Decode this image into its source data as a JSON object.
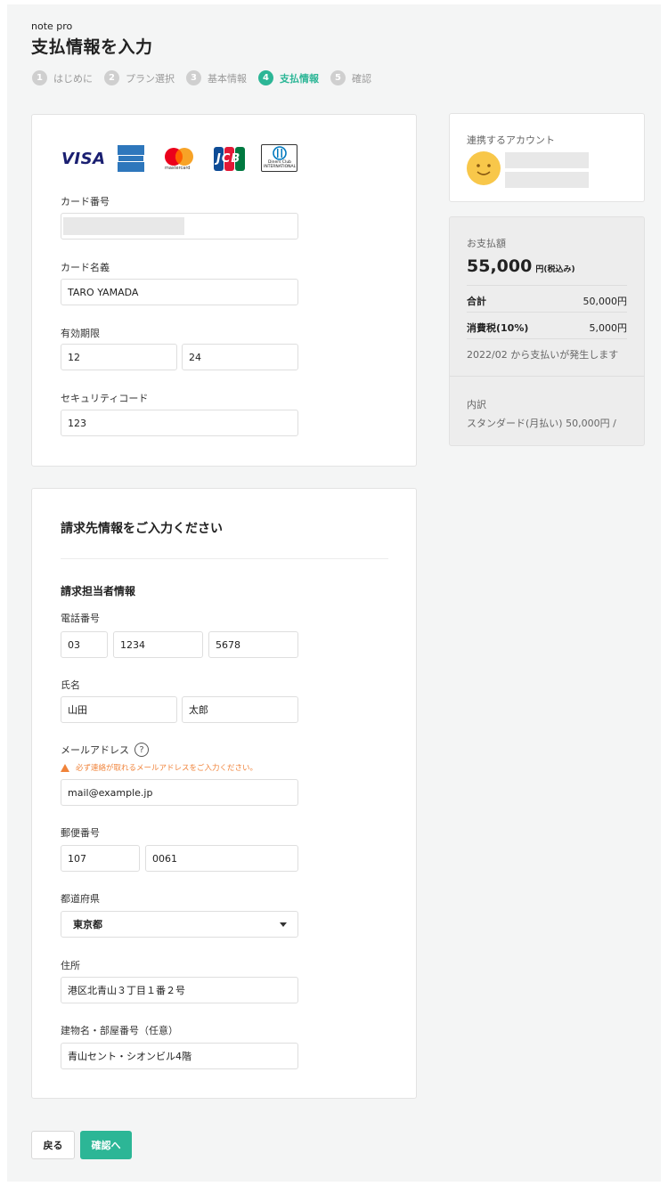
{
  "header": {
    "brand": "note pro",
    "title": "支払情報を入力",
    "steps": [
      {
        "num": "1",
        "label": "はじめに"
      },
      {
        "num": "2",
        "label": "プラン選択"
      },
      {
        "num": "3",
        "label": "基本情報"
      },
      {
        "num": "4",
        "label": "支払情報"
      },
      {
        "num": "5",
        "label": "確認"
      }
    ]
  },
  "card_form": {
    "logos": {
      "visa": "VISA",
      "amex": "AMERICAN EXPRESS",
      "mastercard": "mastercard",
      "jcb": "JCB",
      "diners": "Diners Club INTERNATIONAL"
    },
    "card_number_label": "カード番号",
    "card_name_label": "カード名義",
    "card_name_value": "TARO YAMADA",
    "expiry_label": "有効期限",
    "expiry_month": "12",
    "expiry_year": "24",
    "security_label": "セキュリティコード",
    "security_value": "123"
  },
  "billing": {
    "section_title": "請求先情報をご入力ください",
    "sub_title": "請求担当者情報",
    "phone_label": "電話番号",
    "phone": [
      "03",
      "1234",
      "5678"
    ],
    "name_label": "氏名",
    "last_name": "山田",
    "first_name": "太郎",
    "email_label": "メールアドレス",
    "email_help_icon": "?",
    "email_warning": "必ず連絡が取れるメールアドレスをご入力ください。",
    "email_value": "mail@example.jp",
    "postal_label": "郵便番号",
    "postal": [
      "107",
      "0061"
    ],
    "prefecture_label": "都道府県",
    "prefecture_value": "東京都",
    "address_label": "住所",
    "address_value": "港区北青山３丁目１番２号",
    "building_label": "建物名・部屋番号（任意）",
    "building_value": "青山セント・シオンビル4階"
  },
  "account": {
    "label": "連携するアカウント",
    "avatar_icon": "smiley-face-icon"
  },
  "summary": {
    "amount_label": "お支払額",
    "amount": "55,000",
    "amount_unit": "円(税込み)",
    "subtotal_label": "合計",
    "subtotal": "50,000円",
    "tax_label": "消費税(10%)",
    "tax": "5,000円",
    "note": "2022/02 から支払いが発生します",
    "breakdown_label": "内訳",
    "breakdown": "スタンダード(月払い) 50,000円 /"
  },
  "footer": {
    "back_label": "戻る",
    "confirm_label": "確認へ"
  },
  "colors": {
    "accent": "#2cb696",
    "warning": "#f0833a"
  }
}
